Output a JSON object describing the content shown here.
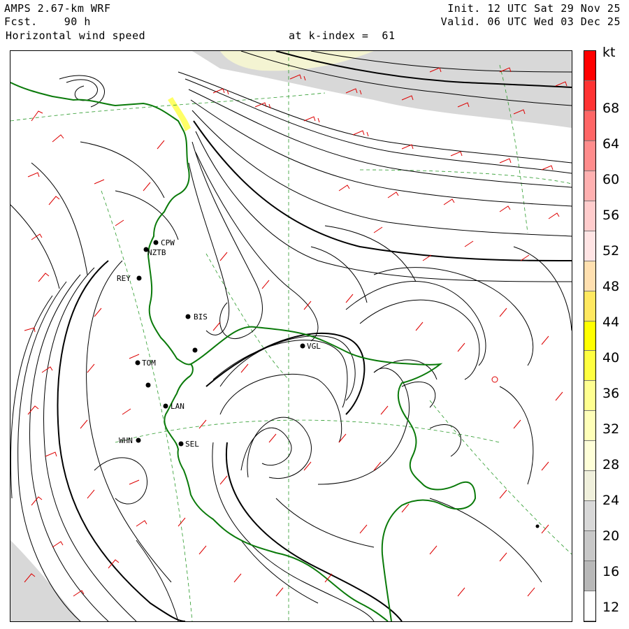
{
  "header": {
    "model": "AMPS 2.67-km WRF",
    "forecast": "Fcst.    90 h",
    "variable": "Horizontal wind speed",
    "level": "at k-index =  61",
    "init": "Init. 12 UTC Sat 29 Nov 25",
    "valid": "Valid. 06 UTC Wed 03 Dec 25"
  },
  "colorbar": {
    "unit": "kt",
    "labels": [
      "68",
      "64",
      "60",
      "56",
      "52",
      "48",
      "44",
      "40",
      "36",
      "32",
      "28",
      "24",
      "20",
      "16",
      "12"
    ],
    "colors": [
      "#ff0000",
      "#ff3333",
      "#ff6666",
      "#ff8c8c",
      "#ffb0b0",
      "#ffcccc",
      "#ffe4e4",
      "#ffe0b0",
      "#ffe860",
      "#ffff00",
      "#ffff40",
      "#ffff90",
      "#ffffb8",
      "#ffffd8",
      "#f0f0dc",
      "#d8d8d8",
      "#c8c8c8",
      "#b8b8b8",
      "#ffffff"
    ]
  },
  "stations": [
    {
      "id": "CPW",
      "label": "CPW"
    },
    {
      "id": "NZTB",
      "label": "NZTB"
    },
    {
      "id": "REY",
      "label": "REY"
    },
    {
      "id": "BIS",
      "label": "BIS"
    },
    {
      "id": "UNNAMED1",
      "label": ""
    },
    {
      "id": "VGL",
      "label": "VGL"
    },
    {
      "id": "TOM",
      "label": "TOM"
    },
    {
      "id": "UNNAMED2",
      "label": ""
    },
    {
      "id": "LAN",
      "label": "LAN"
    },
    {
      "id": "SEL",
      "label": "SEL"
    },
    {
      "id": "WHN",
      "label": "WHN"
    },
    {
      "id": "UNNAMED3",
      "label": ""
    }
  ],
  "colors": {
    "coastline": "#0a7a0a",
    "streamline": "#000000",
    "wind_barb": "#dd0000",
    "grid": "#2a9a2a",
    "fast_wind_shading": "#d0d0d0",
    "jet_shading": "#ffffcc"
  }
}
